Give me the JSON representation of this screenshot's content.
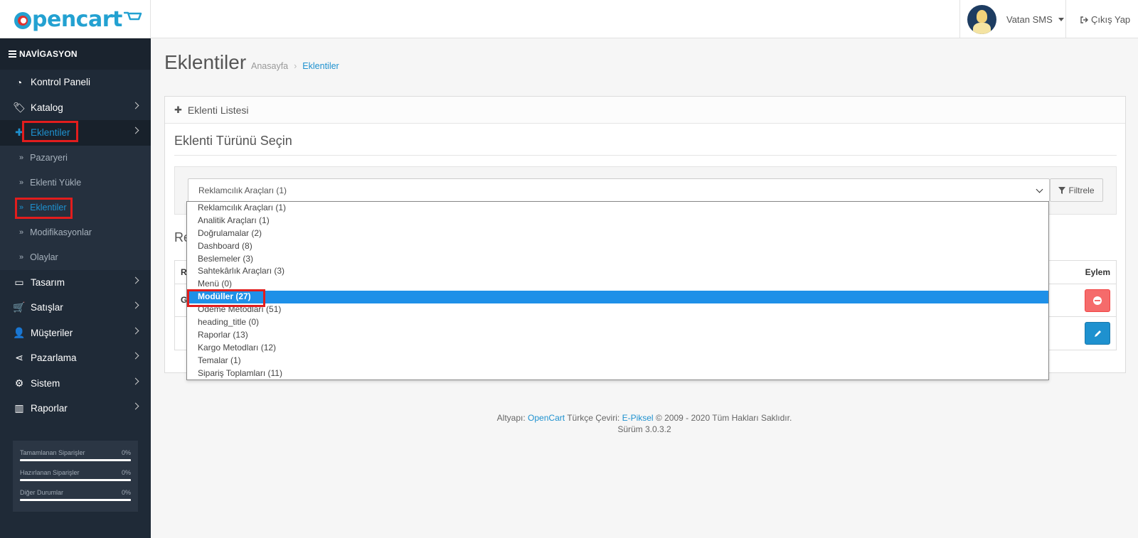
{
  "header": {
    "user_name": "Vatan SMS",
    "logout_label": "Çıkış Yap"
  },
  "sidebar": {
    "title": "NAVİGASYON",
    "items": [
      {
        "label": "Kontrol Paneli",
        "icon": "dashboard-icon"
      },
      {
        "label": "Katalog",
        "icon": "tags-icon"
      },
      {
        "label": "Eklentiler",
        "icon": "puzzle-icon"
      },
      {
        "label": "Tasarım",
        "icon": "monitor-icon"
      },
      {
        "label": "Satışlar",
        "icon": "cart-icon"
      },
      {
        "label": "Müşteriler",
        "icon": "user-icon"
      },
      {
        "label": "Pazarlama",
        "icon": "share-icon"
      },
      {
        "label": "Sistem",
        "icon": "gear-icon"
      },
      {
        "label": "Raporlar",
        "icon": "bar-chart-icon"
      }
    ],
    "sub_items": [
      {
        "label": "Pazaryeri"
      },
      {
        "label": "Eklenti Yükle"
      },
      {
        "label": "Eklentiler"
      },
      {
        "label": "Modifikasyonlar"
      },
      {
        "label": "Olaylar"
      }
    ],
    "stats": [
      {
        "label": "Tamamlanan Siparişler",
        "value": "0%"
      },
      {
        "label": "Hazırlanan Siparişler",
        "value": "0%"
      },
      {
        "label": "Diğer Durumlar",
        "value": "0%"
      }
    ]
  },
  "main": {
    "page_title": "Eklentiler",
    "breadcrumb": {
      "home": "Anasayfa",
      "sep": "›",
      "current": "Eklentiler"
    },
    "panel_title": "Eklenti Listesi",
    "section_title": "Eklenti Türünü Seçin",
    "select_value": "Reklamcılık Araçları (1)",
    "filter_label": "Filtrele",
    "partial_title": "Re",
    "table": {
      "col1_partial": "Re",
      "action_header": "Eylem",
      "row1_partial": "G"
    },
    "dropdown_options": [
      "Reklamcılık Araçları (1)",
      "Analitik Araçları (1)",
      "Doğrulamalar (2)",
      "Dashboard (8)",
      "Beslemeler (3)",
      "Sahtekârlık Araçları (3)",
      "Menü (0)",
      "Modüller (27)",
      "Ödeme Metodları (51)",
      "heading_title (0)",
      "Raporlar (13)",
      "Kargo Metodları (12)",
      "Temalar (1)",
      "Sipariş Toplamları (11)"
    ],
    "selected_option_index": 7
  },
  "footer": {
    "prefix": "Altyapı:",
    "opencart": "OpenCart",
    "mid": "Türkçe Çeviri:",
    "epiksel": "E-Piksel",
    "suffix": "© 2009 - 2020 Tüm Hakları Saklıdır.",
    "version": "Sürüm 3.0.3.2"
  },
  "colors": {
    "accent": "#1e91cf",
    "sidebar_bg": "#1f2a37",
    "highlight": "#e21d1d",
    "danger": "#f56b6b"
  }
}
